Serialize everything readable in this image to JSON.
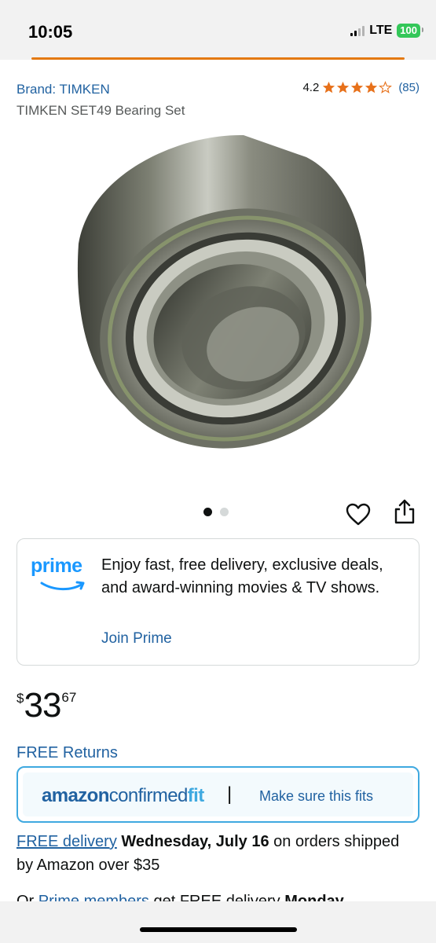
{
  "status_bar": {
    "time": "10:05",
    "network": "LTE",
    "battery": "100"
  },
  "product": {
    "brand_link": "Brand: TIMKEN",
    "title": "TIMKEN SET49 Bearing Set",
    "rating_value": "4.2",
    "rating_stars": 4.2,
    "rating_count": "(85)",
    "image_icon": "wheel-bearing-image",
    "carousel": {
      "total": 2,
      "active": 1
    }
  },
  "actions": {
    "heart_icon": "heart-icon",
    "share_icon": "share-icon"
  },
  "prime": {
    "logo": "prime",
    "text": "Enjoy fast, free delivery, exclusive deals, and award-winning movies & TV shows.",
    "join_label": "Join Prime"
  },
  "price": {
    "symbol": "$",
    "whole": "33",
    "fraction": "67"
  },
  "returns": {
    "label": "FREE Returns"
  },
  "confirmed_fit": {
    "logo_part1": "amazon",
    "logo_part2": "confirmed",
    "logo_part3": "fit",
    "divider": "|",
    "link": "Make sure this fits"
  },
  "delivery": {
    "free_delivery_link": "FREE delivery",
    "date": "Wednesday, July 16",
    "rest": "on orders shipped by Amazon over $35",
    "line2_prefix": "Or",
    "line2_link": "Prime members",
    "line2_text": "get FREE delivery",
    "line2_bold": "Monday"
  },
  "colors": {
    "link": "#2162a1",
    "accent_orange": "#e47911",
    "prime_blue": "#1a98ff",
    "star": "#e7711b",
    "fit_border": "#3fa9e0"
  }
}
